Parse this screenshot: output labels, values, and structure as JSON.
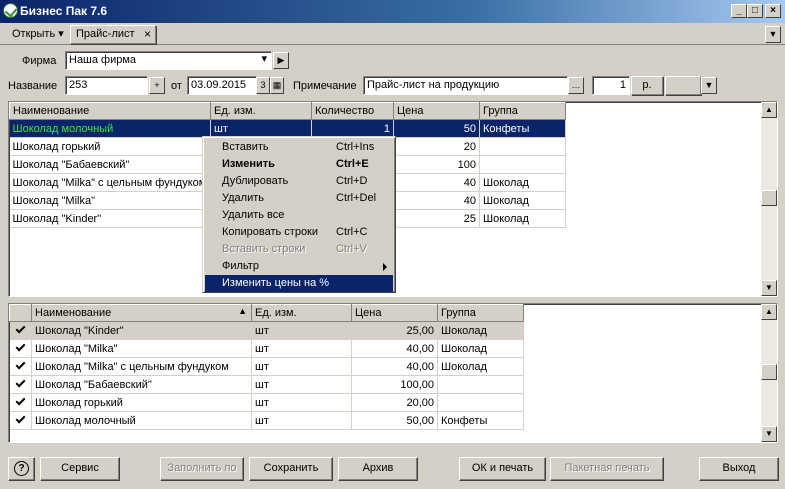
{
  "window": {
    "title": "Бизнес Пак 7.6"
  },
  "toolbar": {
    "open_label": "Открыть",
    "tab_label": "Прайс-лист"
  },
  "form": {
    "firma_label": "Фирма",
    "firma_value": "Наша фирма",
    "name_label": "Название",
    "name_value": "253",
    "ot_label": "от",
    "date_value": "03.09.2015",
    "note_label": "Примечание",
    "note_value": "Прайс-лист на продукцию",
    "count_value": "1",
    "currency_value": "р."
  },
  "top_grid": {
    "columns": [
      "Наименование",
      "Ед. изм.",
      "Количество",
      "Цена",
      "Группа"
    ],
    "rows": [
      [
        "Шоколад молочный",
        "шт",
        "1",
        "50",
        "Конфеты"
      ],
      [
        "Шоколад горький",
        "",
        "",
        "20",
        ""
      ],
      [
        "Шоколад \"Бабаевский\"",
        "",
        "",
        "100",
        ""
      ],
      [
        "Шоколад \"Milka\" с цельным фундуком",
        "",
        "",
        "40",
        "Шоколад"
      ],
      [
        "Шоколад \"Milka\"",
        "",
        "",
        "40",
        "Шоколад"
      ],
      [
        "Шоколад \"Kinder\"",
        "",
        "",
        "25",
        "Шоколад"
      ]
    ]
  },
  "context_menu": [
    {
      "label": "Вставить",
      "shortcut": "Ctrl+Ins"
    },
    {
      "label": "Изменить",
      "shortcut": "Ctrl+E"
    },
    {
      "label": "Дублировать",
      "shortcut": "Ctrl+D"
    },
    {
      "label": "Удалить",
      "shortcut": "Ctrl+Del"
    },
    {
      "label": "Удалить все",
      "shortcut": ""
    },
    {
      "label": "Копировать строки",
      "shortcut": "Ctrl+C"
    },
    {
      "label": "Вставить строки",
      "shortcut": "Ctrl+V"
    },
    {
      "label": "Фильтр",
      "shortcut": ""
    },
    {
      "label": "Изменить цены на %",
      "shortcut": ""
    }
  ],
  "bottom_grid": {
    "columns": [
      "Наименование",
      "Ед. изм.",
      "Цена",
      "Группа"
    ],
    "rows": [
      [
        "Шоколад \"Kinder\"",
        "шт",
        "25,00",
        "Шоколад"
      ],
      [
        "Шоколад \"Milka\"",
        "шт",
        "40,00",
        "Шоколад"
      ],
      [
        "Шоколад \"Milka\" с цельным фундуком",
        "шт",
        "40,00",
        "Шоколад"
      ],
      [
        "Шоколад \"Бабаевский\"",
        "шт",
        "100,00",
        ""
      ],
      [
        "Шоколад горький",
        "шт",
        "20,00",
        ""
      ],
      [
        "Шоколад молочный",
        "шт",
        "50,00",
        "Конфеты"
      ]
    ]
  },
  "footer": {
    "help": "?",
    "service": "Сервис",
    "fill": "Заполнить по",
    "save": "Сохранить",
    "archive": "Архив",
    "ok_print": "ОК и печать",
    "batch_print": "Пакетная печать",
    "exit": "Выход"
  }
}
